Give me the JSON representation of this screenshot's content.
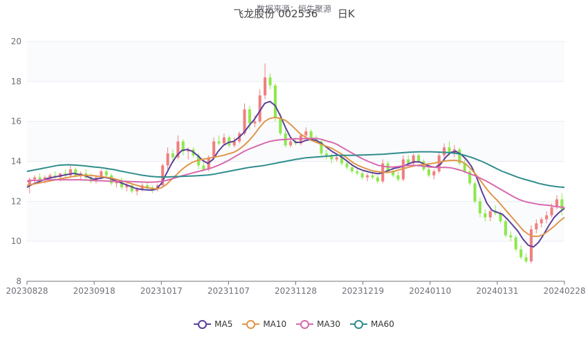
{
  "source_text": "数据来源：恒生聚源",
  "title_name": "飞龙股份 002536",
  "title_period": "日K",
  "legend": [
    {
      "name": "MA5",
      "color": "#5b3e9a"
    },
    {
      "name": "MA10",
      "color": "#e0954a"
    },
    {
      "name": "MA30",
      "color": "#d868ac"
    },
    {
      "name": "MA60",
      "color": "#2f8c8c"
    }
  ],
  "colors": {
    "up": "#f07f7f",
    "down": "#8de84e",
    "grid": "#e9ecf3",
    "axis": "#6e7079"
  },
  "chart_data": {
    "type": "candlestick",
    "title": "飞龙股份 002536 日K",
    "ylim": [
      8,
      20
    ],
    "yticks": [
      8,
      10,
      12,
      14,
      16,
      18,
      20
    ],
    "x_tick_labels": [
      "20230828",
      "20230918",
      "20231017",
      "20231107",
      "20231128",
      "20231219",
      "20240110",
      "20240131",
      "20240228"
    ],
    "grid": true,
    "legend_position": "bottom",
    "dates_start": "20230828",
    "dates_end": "20240228",
    "ohlc_approx": [
      [
        12.8,
        13.2,
        12.4,
        13.1
      ],
      [
        13.1,
        13.3,
        12.9,
        13.2
      ],
      [
        13.2,
        13.4,
        13.0,
        13.1
      ],
      [
        13.1,
        13.3,
        12.9,
        13.2
      ],
      [
        13.2,
        13.4,
        13.0,
        13.3
      ],
      [
        13.3,
        13.5,
        13.1,
        13.2
      ],
      [
        13.2,
        13.4,
        13.0,
        13.4
      ],
      [
        13.4,
        13.6,
        13.2,
        13.3
      ],
      [
        13.3,
        13.8,
        13.2,
        13.6
      ],
      [
        13.6,
        13.7,
        13.2,
        13.3
      ],
      [
        13.3,
        13.5,
        13.1,
        13.4
      ],
      [
        13.4,
        13.6,
        13.1,
        13.2
      ],
      [
        13.2,
        13.4,
        12.9,
        13.0
      ],
      [
        13.0,
        13.3,
        12.9,
        13.2
      ],
      [
        13.2,
        13.6,
        13.1,
        13.5
      ],
      [
        13.5,
        13.6,
        13.2,
        13.3
      ],
      [
        13.3,
        13.4,
        12.8,
        12.9
      ],
      [
        12.9,
        13.1,
        12.7,
        13.0
      ],
      [
        13.0,
        13.2,
        12.6,
        12.7
      ],
      [
        12.7,
        12.9,
        12.5,
        12.8
      ],
      [
        12.8,
        12.9,
        12.4,
        12.5
      ],
      [
        12.5,
        12.7,
        12.3,
        12.6
      ],
      [
        12.6,
        12.9,
        12.5,
        12.8
      ],
      [
        12.8,
        13.0,
        12.6,
        12.7
      ],
      [
        12.7,
        12.8,
        12.4,
        12.6
      ],
      [
        12.6,
        12.9,
        12.5,
        12.8
      ],
      [
        12.8,
        13.9,
        12.7,
        13.8
      ],
      [
        13.8,
        14.7,
        13.6,
        14.4
      ],
      [
        14.4,
        14.6,
        14.0,
        14.2
      ],
      [
        14.2,
        15.3,
        14.1,
        15.0
      ],
      [
        15.0,
        15.1,
        14.3,
        14.5
      ],
      [
        14.5,
        14.7,
        14.1,
        14.6
      ],
      [
        14.6,
        14.7,
        14.2,
        14.3
      ],
      [
        14.3,
        14.4,
        13.6,
        13.8
      ],
      [
        13.8,
        14.0,
        13.5,
        13.6
      ],
      [
        13.6,
        14.3,
        13.5,
        14.2
      ],
      [
        14.2,
        15.2,
        14.1,
        15.0
      ],
      [
        15.0,
        15.3,
        14.8,
        14.9
      ],
      [
        14.9,
        15.4,
        14.8,
        15.2
      ],
      [
        15.2,
        15.3,
        14.7,
        14.8
      ],
      [
        14.8,
        15.2,
        14.7,
        15.0
      ],
      [
        15.0,
        15.5,
        14.9,
        15.4
      ],
      [
        15.4,
        16.9,
        15.3,
        16.6
      ],
      [
        16.6,
        16.8,
        15.6,
        15.9
      ],
      [
        15.9,
        16.3,
        15.7,
        16.0
      ],
      [
        16.0,
        17.6,
        15.9,
        17.3
      ],
      [
        17.3,
        18.9,
        17.1,
        18.2
      ],
      [
        18.2,
        18.4,
        17.6,
        17.8
      ],
      [
        17.8,
        17.9,
        16.0,
        16.2
      ],
      [
        16.2,
        16.4,
        15.3,
        15.4
      ],
      [
        15.4,
        15.6,
        14.7,
        14.8
      ],
      [
        14.8,
        15.1,
        14.7,
        15.0
      ],
      [
        15.0,
        15.2,
        14.8,
        14.9
      ],
      [
        14.9,
        15.4,
        14.8,
        15.3
      ],
      [
        15.3,
        15.7,
        15.1,
        15.5
      ],
      [
        15.5,
        15.6,
        15.0,
        15.1
      ],
      [
        15.1,
        15.3,
        14.9,
        15.0
      ],
      [
        15.0,
        15.1,
        14.3,
        14.4
      ],
      [
        14.4,
        14.6,
        14.1,
        14.3
      ],
      [
        14.3,
        14.4,
        13.9,
        14.1
      ],
      [
        14.1,
        14.4,
        14.0,
        14.2
      ],
      [
        14.2,
        14.4,
        13.8,
        13.9
      ],
      [
        13.9,
        14.0,
        13.6,
        13.7
      ],
      [
        13.7,
        13.9,
        13.4,
        13.5
      ],
      [
        13.5,
        13.6,
        13.3,
        13.4
      ],
      [
        13.4,
        13.5,
        13.1,
        13.2
      ],
      [
        13.2,
        13.4,
        13.0,
        13.3
      ],
      [
        13.3,
        13.5,
        13.1,
        13.2
      ],
      [
        13.2,
        13.3,
        12.9,
        13.0
      ],
      [
        13.0,
        14.1,
        12.9,
        13.9
      ],
      [
        13.9,
        14.0,
        13.4,
        13.5
      ],
      [
        13.5,
        13.6,
        13.2,
        13.3
      ],
      [
        13.3,
        13.5,
        13.0,
        13.1
      ],
      [
        13.1,
        14.3,
        13.0,
        14.1
      ],
      [
        14.1,
        14.3,
        13.8,
        13.9
      ],
      [
        13.9,
        14.4,
        13.8,
        14.3
      ],
      [
        14.3,
        14.4,
        13.9,
        14.0
      ],
      [
        14.0,
        14.1,
        13.5,
        13.6
      ],
      [
        13.6,
        13.8,
        13.2,
        13.3
      ],
      [
        13.3,
        13.6,
        13.1,
        13.5
      ],
      [
        13.5,
        14.5,
        13.4,
        14.3
      ],
      [
        14.3,
        14.9,
        14.1,
        14.7
      ],
      [
        14.7,
        15.0,
        14.3,
        14.4
      ],
      [
        14.4,
        14.8,
        14.2,
        14.6
      ],
      [
        14.6,
        14.7,
        13.8,
        13.9
      ],
      [
        13.9,
        14.1,
        13.4,
        13.5
      ],
      [
        13.5,
        13.6,
        12.8,
        12.9
      ],
      [
        12.9,
        13.0,
        11.9,
        12.0
      ],
      [
        12.0,
        12.2,
        11.2,
        11.4
      ],
      [
        11.4,
        11.6,
        11.0,
        11.2
      ],
      [
        11.2,
        11.6,
        11.0,
        11.5
      ],
      [
        11.5,
        11.8,
        11.3,
        11.4
      ],
      [
        11.4,
        11.5,
        10.9,
        11.0
      ],
      [
        11.0,
        11.1,
        10.2,
        10.3
      ],
      [
        10.3,
        10.5,
        10.0,
        10.2
      ],
      [
        10.2,
        10.3,
        9.5,
        9.6
      ],
      [
        9.6,
        9.8,
        9.1,
        9.2
      ],
      [
        9.2,
        9.4,
        8.9,
        9.0
      ],
      [
        9.0,
        10.8,
        8.9,
        10.6
      ],
      [
        10.6,
        11.1,
        10.4,
        10.9
      ],
      [
        10.9,
        11.2,
        10.7,
        11.1
      ],
      [
        11.1,
        11.5,
        10.9,
        11.3
      ],
      [
        11.3,
        11.9,
        11.2,
        11.7
      ],
      [
        11.7,
        12.3,
        11.6,
        12.1
      ],
      [
        12.1,
        12.4,
        11.3,
        11.6
      ]
    ],
    "series": [
      {
        "name": "MA5",
        "values": [
          12.7,
          12.85,
          12.95,
          13.05,
          13.15,
          13.2,
          13.25,
          13.3,
          13.35,
          13.4,
          13.35,
          13.3,
          13.2,
          13.1,
          13.15,
          13.2,
          13.15,
          13.05,
          12.95,
          12.85,
          12.75,
          12.65,
          12.6,
          12.58,
          12.56,
          12.6,
          12.9,
          13.4,
          13.9,
          14.3,
          14.55,
          14.6,
          14.5,
          14.3,
          14.05,
          13.9,
          14.1,
          14.5,
          14.8,
          14.95,
          15.0,
          15.2,
          15.45,
          15.8,
          16.1,
          16.5,
          16.9,
          17.0,
          16.8,
          16.3,
          15.7,
          15.2,
          14.95,
          14.95,
          15.05,
          15.1,
          15.05,
          14.9,
          14.7,
          14.5,
          14.35,
          14.2,
          14.0,
          13.8,
          13.65,
          13.55,
          13.48,
          13.42,
          13.38,
          13.45,
          13.55,
          13.65,
          13.7,
          13.78,
          13.9,
          13.98,
          13.97,
          13.85,
          13.75,
          13.7,
          13.85,
          14.2,
          14.45,
          14.5,
          14.35,
          14.1,
          13.75,
          13.2,
          12.5,
          11.9,
          11.55,
          11.45,
          11.35,
          11.1,
          10.8,
          10.5,
          10.1,
          9.8,
          9.72,
          9.95,
          10.35,
          10.8,
          11.2,
          11.45,
          11.65
        ]
      },
      {
        "name": "MA10",
        "values": [
          12.8,
          12.85,
          12.9,
          12.95,
          13.0,
          13.05,
          13.1,
          13.15,
          13.2,
          13.25,
          13.28,
          13.3,
          13.3,
          13.28,
          13.25,
          13.22,
          13.18,
          13.12,
          13.05,
          12.98,
          12.9,
          12.82,
          12.75,
          12.7,
          12.65,
          12.62,
          12.68,
          12.85,
          13.1,
          13.35,
          13.6,
          13.8,
          13.95,
          14.05,
          14.1,
          14.15,
          14.2,
          14.25,
          14.3,
          14.38,
          14.45,
          14.6,
          14.8,
          15.05,
          15.35,
          15.7,
          16.0,
          16.15,
          16.2,
          16.15,
          16.05,
          15.85,
          15.6,
          15.35,
          15.2,
          15.05,
          14.95,
          14.85,
          14.75,
          14.65,
          14.5,
          14.35,
          14.15,
          13.95,
          13.8,
          13.7,
          13.6,
          13.52,
          13.48,
          13.45,
          13.45,
          13.5,
          13.58,
          13.65,
          13.72,
          13.78,
          13.82,
          13.85,
          13.88,
          13.92,
          13.98,
          14.02,
          14.05,
          14.05,
          14.0,
          13.85,
          13.6,
          13.3,
          12.95,
          12.6,
          12.3,
          12.05,
          11.75,
          11.45,
          11.15,
          10.85,
          10.55,
          10.35,
          10.25,
          10.25,
          10.35,
          10.55,
          10.75,
          11.0,
          11.2
        ]
      },
      {
        "name": "MA30",
        "values": [
          13.0,
          13.05,
          13.05,
          13.07,
          13.08,
          13.08,
          13.08,
          13.08,
          13.08,
          13.08,
          13.08,
          13.07,
          13.06,
          13.04,
          13.03,
          13.02,
          13.01,
          13.0,
          13.0,
          13.0,
          12.99,
          12.98,
          12.97,
          12.96,
          12.96,
          12.97,
          13.0,
          13.05,
          13.12,
          13.2,
          13.28,
          13.35,
          13.42,
          13.48,
          13.55,
          13.62,
          13.7,
          13.8,
          13.92,
          14.05,
          14.2,
          14.35,
          14.5,
          14.62,
          14.72,
          14.82,
          14.92,
          15.0,
          15.05,
          15.08,
          15.1,
          15.12,
          15.13,
          15.13,
          15.14,
          15.15,
          15.15,
          15.1,
          15.02,
          14.95,
          14.85,
          14.7,
          14.55,
          14.4,
          14.25,
          14.12,
          14.0,
          13.9,
          13.8,
          13.75,
          13.72,
          13.72,
          13.75,
          13.78,
          13.8,
          13.8,
          13.78,
          13.75,
          13.72,
          13.7,
          13.7,
          13.7,
          13.68,
          13.62,
          13.55,
          13.45,
          13.35,
          13.25,
          13.12,
          13.0,
          12.85,
          12.7,
          12.55,
          12.4,
          12.25,
          12.12,
          12.02,
          11.95,
          11.9,
          11.85,
          11.82,
          11.8,
          11.75,
          11.72,
          11.7
        ]
      },
      {
        "name": "MA60",
        "values": [
          13.5,
          13.55,
          13.6,
          13.65,
          13.7,
          13.75,
          13.8,
          13.82,
          13.83,
          13.82,
          13.8,
          13.78,
          13.75,
          13.72,
          13.7,
          13.66,
          13.62,
          13.58,
          13.52,
          13.47,
          13.42,
          13.37,
          13.32,
          13.28,
          13.25,
          13.23,
          13.22,
          13.22,
          13.23,
          13.24,
          13.25,
          13.26,
          13.27,
          13.28,
          13.3,
          13.32,
          13.35,
          13.4,
          13.45,
          13.5,
          13.55,
          13.6,
          13.65,
          13.7,
          13.73,
          13.76,
          13.8,
          13.85,
          13.9,
          13.95,
          14.0,
          14.05,
          14.1,
          14.14,
          14.18,
          14.2,
          14.22,
          14.24,
          14.26,
          14.28,
          14.3,
          14.3,
          14.3,
          14.3,
          14.31,
          14.32,
          14.33,
          14.34,
          14.35,
          14.36,
          14.38,
          14.4,
          14.42,
          14.44,
          14.46,
          14.47,
          14.48,
          14.48,
          14.48,
          14.47,
          14.46,
          14.45,
          14.43,
          14.4,
          14.35,
          14.28,
          14.2,
          14.1,
          14.0,
          13.88,
          13.75,
          13.62,
          13.5,
          13.4,
          13.3,
          13.2,
          13.12,
          13.05,
          12.98,
          12.9,
          12.84,
          12.79,
          12.75,
          12.72,
          12.7
        ]
      }
    ]
  }
}
